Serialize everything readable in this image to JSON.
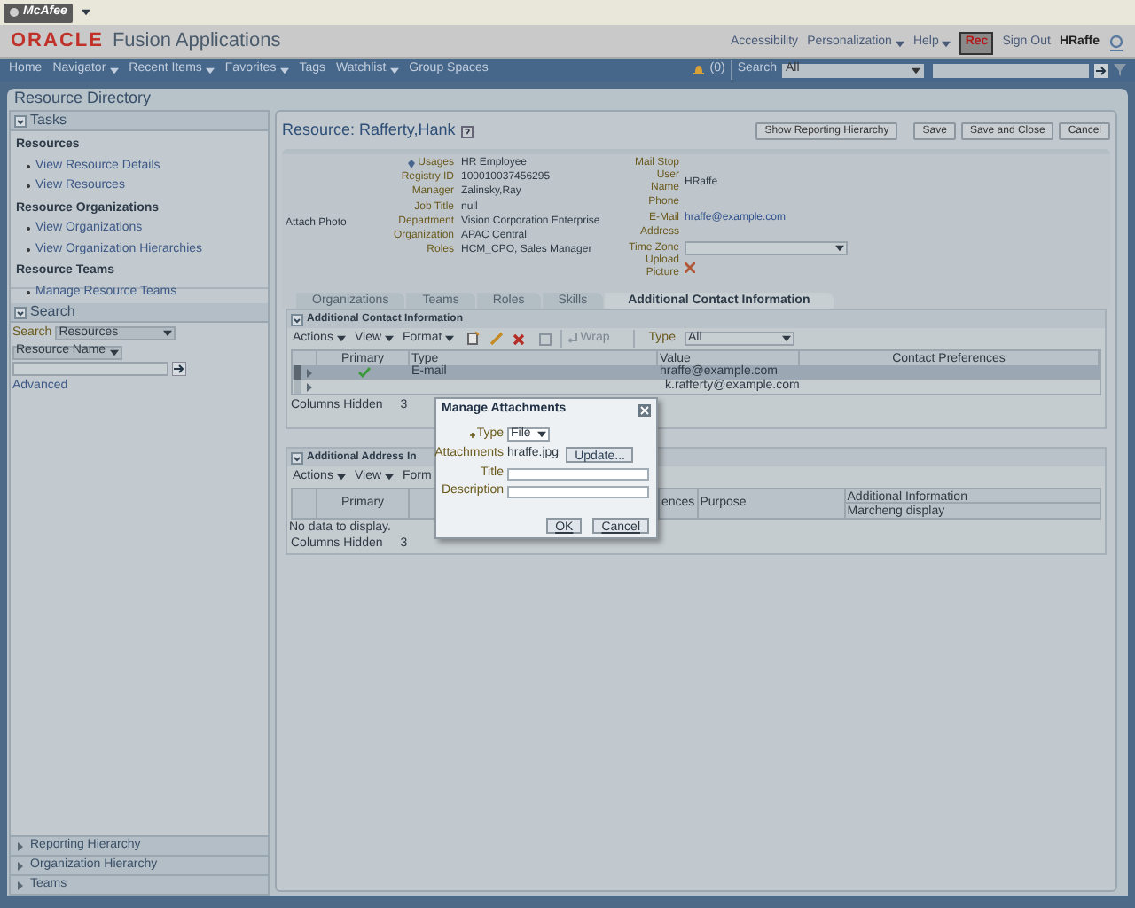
{
  "browser_toolbar": {
    "button": "McAfee"
  },
  "header": {
    "logo": "ORACLE",
    "product": "Fusion Applications",
    "links": [
      {
        "label": "Accessibility",
        "menu": false
      },
      {
        "label": "Personalization",
        "menu": true
      },
      {
        "label": "Help",
        "menu": true
      }
    ],
    "rec": "Rec",
    "sign_out": "Sign Out",
    "user": "HRaffe"
  },
  "nav": {
    "items": [
      {
        "label": "Home",
        "menu": false
      },
      {
        "label": "Navigator",
        "menu": true
      },
      {
        "label": "Recent Items",
        "menu": true
      },
      {
        "label": "Favorites",
        "menu": true
      },
      {
        "label": "Tags",
        "menu": false
      },
      {
        "label": "Watchlist",
        "menu": true
      },
      {
        "label": "Group Spaces",
        "menu": false
      }
    ],
    "notifications": "(0)",
    "search_label": "Search",
    "search_scope": "All"
  },
  "page_title": "Resource Directory",
  "sidebar": {
    "tasks": {
      "title": "Tasks",
      "groups": [
        {
          "title": "Resources",
          "links": [
            "View Resource Details",
            "View Resources"
          ]
        },
        {
          "title": "Resource Organizations",
          "links": [
            "View Organizations",
            "View Organization Hierarchies"
          ]
        },
        {
          "title": "Resource Teams",
          "links": [
            "Manage Resource Teams"
          ]
        }
      ]
    },
    "search": {
      "title": "Search",
      "label": "Search",
      "scope": "Resources",
      "attribute": "Resource Name",
      "advanced": "Advanced"
    },
    "bottom_panels": [
      "Reporting Hierarchy",
      "Organization Hierarchy",
      "Teams"
    ]
  },
  "resource": {
    "title": "Resource: Rafferty,Hank",
    "buttons": [
      "Show Reporting Hierarchy",
      "Save",
      "Save and Close",
      "Cancel"
    ],
    "attach_photo": "Attach Photo",
    "fields_left": [
      {
        "label": "Usages",
        "value": "HR Employee",
        "help": true
      },
      {
        "label": "Registry ID",
        "value": "100010037456295",
        "help": false
      },
      {
        "label": "Manager",
        "value": "Zalinsky,Ray",
        "help": false
      },
      {
        "label": "Job Title",
        "value": "null",
        "help": false
      },
      {
        "label": "Department",
        "value": "Vision Corporation Enterprise",
        "help": false
      },
      {
        "label": "Organization",
        "value": "APAC Central",
        "help": false
      },
      {
        "label": "Roles",
        "value": "HCM_CPO, Sales Manager",
        "help": false
      }
    ],
    "fields_right": [
      {
        "label": "Mail Stop",
        "kind": "text"
      },
      {
        "label": "User Name",
        "kind": "text",
        "value": "HRaffe"
      },
      {
        "label": "Phone",
        "kind": "text"
      },
      {
        "label": "E-Mail",
        "kind": "link",
        "value": "hraffe@example.com"
      },
      {
        "label": "Address",
        "kind": "text"
      },
      {
        "label": "Time Zone",
        "kind": "select"
      },
      {
        "label": "Upload Picture",
        "kind": "upload"
      }
    ],
    "tabs": [
      {
        "label": "Organizations",
        "selected": false
      },
      {
        "label": "Teams",
        "selected": false
      },
      {
        "label": "Roles",
        "selected": false
      },
      {
        "label": "Skills",
        "selected": false
      },
      {
        "label": "Additional Contact Information",
        "selected": true
      }
    ]
  },
  "contact_section": {
    "title": "Additional Contact Information",
    "menus": [
      "Actions",
      "View",
      "Format"
    ],
    "wrap": "Wrap",
    "type_label": "Type",
    "type_value": "All",
    "columns": [
      "Primary",
      "Type",
      "Value",
      "Contact Preferences"
    ],
    "rows": [
      {
        "selected": true,
        "primary": true,
        "type": "E-mail",
        "value": "hraffe@example.com"
      },
      {
        "selected": false,
        "primary": false,
        "value": "k.rafferty@example.com"
      }
    ],
    "columns_hidden_label": "Columns Hidden",
    "columns_hidden": "3"
  },
  "address_section": {
    "title": "Additional Address In",
    "menus": [
      "Actions",
      "View",
      "Form"
    ],
    "columns_left": [
      "Primary"
    ],
    "columns_right": [
      "ences",
      "Purpose"
    ],
    "group_header": "Additional Information",
    "group_sub": "Marcheng display",
    "empty": "No data to display.",
    "columns_hidden_label": "Columns Hidden",
    "columns_hidden": "3"
  },
  "dialog": {
    "title": "Manage Attachments",
    "type_label": "Type",
    "type_value": "File",
    "attachments_label": "Attachments",
    "file": "hraffe.jpg",
    "update": "Update...",
    "title_label": "Title",
    "description_label": "Description",
    "buttons": [
      "OK",
      "Cancel"
    ]
  }
}
